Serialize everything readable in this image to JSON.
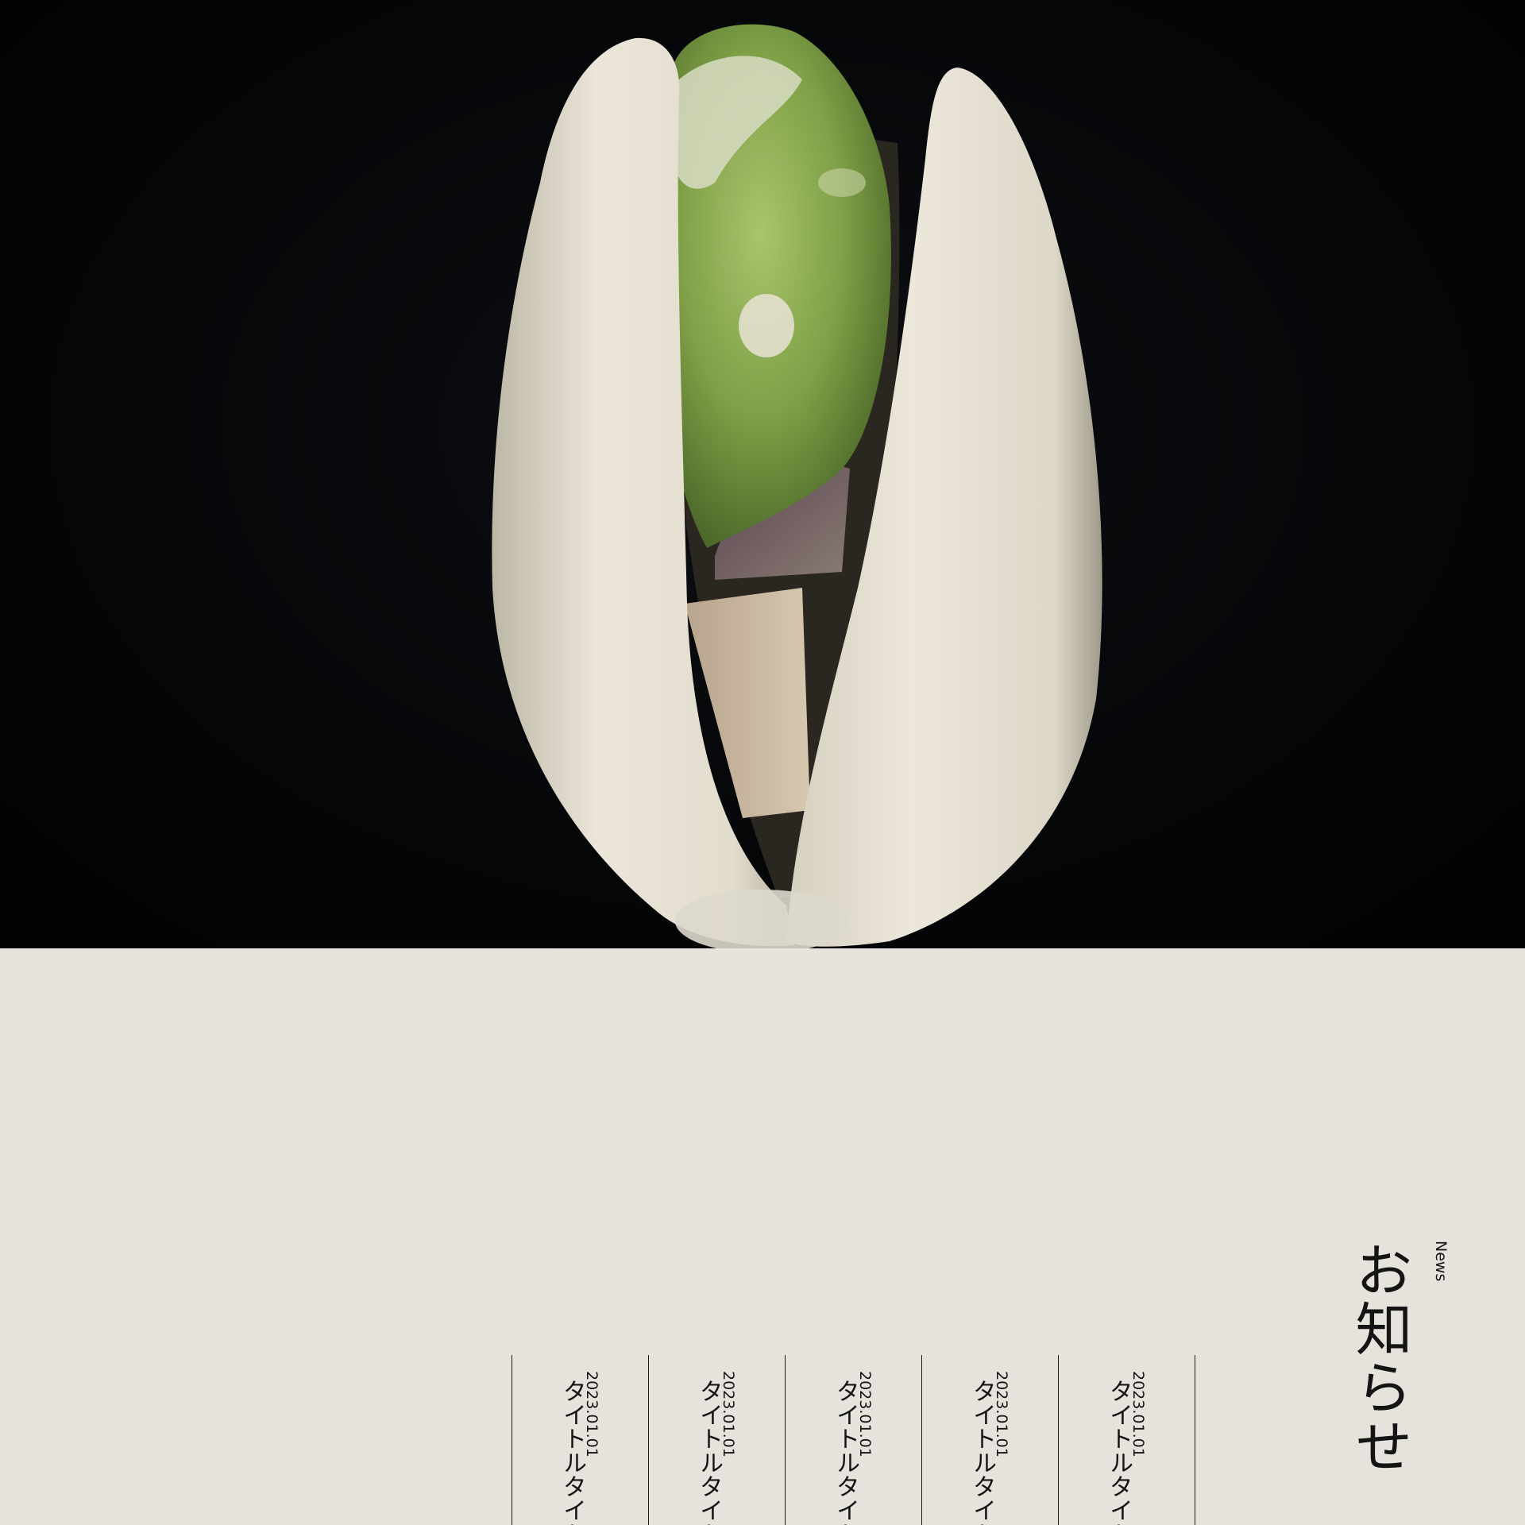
{
  "hero": {
    "image_alt": "pistachio-photo"
  },
  "news": {
    "heading": "お知らせ",
    "label": "News",
    "items": [
      {
        "date": "2023.01.01",
        "title": "タイトルタイトル"
      },
      {
        "date": "2023.01.01",
        "title": "タイトルタイトル"
      },
      {
        "date": "2023.01.01",
        "title": "タイトルタイトル"
      },
      {
        "date": "2023.01.01",
        "title": "タイトルタイトル"
      },
      {
        "date": "2023.01.01",
        "title": "タイトルタイトル"
      }
    ]
  },
  "colors": {
    "section_background": "#e6e3dc",
    "hero_background": "#050608",
    "text": "#141414",
    "shell": "#e4dfd1",
    "kernel": "#7fa24a"
  }
}
